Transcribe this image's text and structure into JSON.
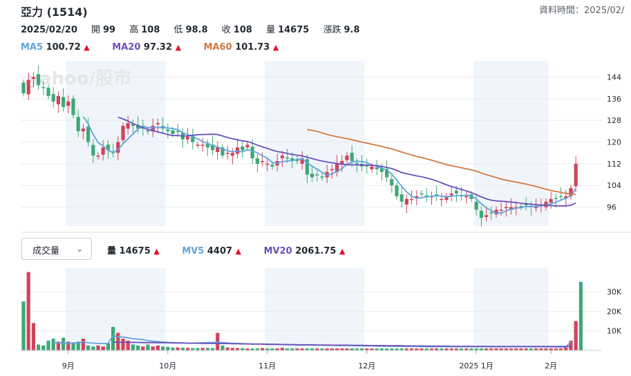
{
  "header": {
    "title": "亞力 (1514)",
    "datetime": "資料時間：2025/02/",
    "date": "2025/02/20",
    "open_label": "開",
    "open": "99",
    "high_label": "高",
    "high": "108",
    "low_label": "低",
    "low": "98.8",
    "close_label": "收",
    "close": "108",
    "volume_label": "量",
    "volume": "14675",
    "change_label": "漲跌",
    "change": "9.8"
  },
  "ma_legend": [
    {
      "name": "MA5",
      "value": "100.72",
      "color": "#5fa4dc"
    },
    {
      "name": "MA20",
      "value": "97.32",
      "color": "#6b4fbb"
    },
    {
      "name": "MA60",
      "value": "101.73",
      "color": "#d4783f"
    }
  ],
  "up_arrow": "▲",
  "watermark": "yahoo/股市",
  "volume_selector": {
    "label": "成交量",
    "chevron": "chevron-down"
  },
  "volume_legend": [
    {
      "name": "量",
      "value": "14675",
      "color": "#232a31"
    },
    {
      "name": "MV5",
      "value": "4407",
      "color": "#5fa4dc"
    },
    {
      "name": "MV20",
      "value": "2061.75",
      "color": "#6b4fbb"
    }
  ],
  "colors": {
    "up": "#d1435b",
    "down": "#3ea876",
    "band": "#f0f5fb",
    "grid": "#e8eaec"
  },
  "chart_data": {
    "type": "candlestick",
    "price_axis": {
      "ticks": [
        96,
        104,
        112,
        120,
        128,
        136,
        144
      ],
      "range": [
        89,
        150
      ]
    },
    "volume_axis": {
      "ticks": [
        "10K",
        "20K",
        "30K"
      ],
      "tick_values": [
        10000,
        20000,
        30000
      ],
      "range": [
        0,
        42000
      ]
    },
    "x_labels": [
      "9月",
      "10月",
      "11月",
      "12月",
      "2025 1月",
      "2月"
    ],
    "x_label_index": [
      9,
      29,
      49,
      69,
      91,
      106
    ],
    "shaded_months": [
      [
        9,
        28
      ],
      [
        49,
        68
      ],
      [
        91,
        105
      ]
    ],
    "closes": [
      138,
      143,
      144,
      141,
      140,
      137,
      135,
      137,
      133,
      135,
      130,
      124,
      125,
      120,
      115,
      115,
      118,
      117,
      116,
      120,
      126,
      127,
      126,
      125,
      125,
      124,
      126,
      127,
      125,
      124,
      123,
      124,
      121,
      122,
      120,
      119,
      119,
      118,
      117,
      118,
      115,
      116,
      116,
      118,
      117,
      119,
      114,
      112,
      113,
      112,
      111,
      113,
      115,
      114,
      113,
      113,
      114,
      108,
      107,
      108,
      107,
      109,
      110,
      112,
      113,
      115,
      113,
      112,
      111,
      111,
      111,
      110,
      109,
      107,
      104,
      100,
      98,
      99,
      99,
      100,
      101,
      100,
      100,
      100,
      99,
      100,
      101,
      101,
      100,
      100,
      99,
      95,
      92,
      93,
      94,
      95,
      95,
      96,
      96,
      96,
      96,
      97,
      96,
      96,
      97,
      98,
      99,
      99,
      100,
      100,
      103,
      112
    ],
    "mv5": [
      14000,
      8000,
      5800,
      4800,
      4500,
      4300,
      4000,
      3900,
      3700,
      3600,
      3800,
      4000,
      4200,
      3900,
      3700,
      3600,
      3500,
      3600,
      7500,
      7000,
      6800,
      6500,
      6000,
      5800,
      5600,
      5000,
      4700,
      4500,
      4300,
      4100,
      4000,
      3900,
      3800,
      3700,
      3700,
      3800,
      3900,
      4000,
      4100,
      4100,
      4000,
      3800,
      3700,
      3600,
      3500,
      3400,
      3300,
      3300,
      3300,
      3200,
      3200,
      3100,
      3000,
      2900,
      2900,
      2800,
      2800,
      2800,
      2800,
      2700,
      2700,
      2600,
      2600,
      2500,
      2500,
      2500,
      2500,
      2400,
      2400,
      2300,
      2300,
      2200,
      2200,
      2200,
      2100,
      2100,
      2100,
      2000,
      2000,
      2000,
      1900,
      1900,
      1900,
      1900,
      1900,
      1900,
      1900,
      1900,
      1900,
      1900,
      1900,
      1900,
      1900,
      1900,
      1900,
      1900,
      1900,
      1900,
      1900,
      1900,
      1900,
      1900,
      1900,
      1900,
      1900,
      1800,
      1800,
      1800,
      1700,
      1800,
      4400
    ],
    "mv20": [
      5500,
      5300,
      5100,
      5000,
      4900,
      4800,
      4700,
      4600,
      4500,
      4400,
      4300,
      4300,
      4200,
      4200,
      4100,
      4100,
      4000,
      4000,
      4200,
      4200,
      4200,
      4200,
      4100,
      4100,
      4000,
      4000,
      4000,
      3900,
      3900,
      3900,
      3800,
      3800,
      3800,
      3700,
      3700,
      3700,
      3600,
      3600,
      3600,
      3500,
      3500,
      3500,
      3400,
      3400,
      3300,
      3300,
      3200,
      3200,
      3200,
      3100,
      3100,
      3100,
      3000,
      3000,
      3000,
      2900,
      2900,
      2900,
      2900,
      2800,
      2800,
      2800,
      2700,
      2700,
      2700,
      2700,
      2600,
      2600,
      2600,
      2500,
      2500,
      2500,
      2500,
      2400,
      2400,
      2400,
      2400,
      2300,
      2300,
      2300,
      2300,
      2200,
      2200,
      2200,
      2200,
      2200,
      2100,
      2100,
      2100,
      2100,
      2100,
      2100,
      2100,
      2100,
      2000,
      2000,
      2000,
      2000,
      2000,
      2000,
      2000,
      2000,
      2000,
      2000,
      2000,
      2000,
      2000,
      2000,
      2000,
      2000,
      2061.75
    ],
    "ma60_start": 57,
    "volumes": [
      25000,
      40000,
      14000,
      3000,
      2500,
      5000,
      6000,
      4500,
      6500,
      4500,
      4000,
      4500,
      6000,
      2500,
      2000,
      2500,
      2000,
      3500,
      12000,
      9000,
      6000,
      5000,
      3000,
      2500,
      2000,
      3000,
      2000,
      2500,
      2000,
      1800,
      1500,
      1500,
      1400,
      1300,
      1200,
      1200,
      1300,
      1300,
      1200,
      9000,
      2500,
      1500,
      1300,
      1200,
      1200,
      1000,
      1000,
      1000,
      1200,
      1000,
      1000,
      1000,
      1300,
      1000,
      1000,
      1000,
      1000,
      1000,
      1000,
      1000,
      1000,
      1000,
      1000,
      1000,
      1000,
      1000,
      1000,
      1000,
      1000,
      1000,
      1000,
      1000,
      1000,
      1000,
      1000,
      1000,
      1000,
      1000,
      1000,
      1000,
      1000,
      1000,
      1000,
      1000,
      1000,
      1000,
      1000,
      1000,
      1000,
      1000,
      1000,
      1000,
      1000,
      1000,
      1000,
      1000,
      1000,
      1000,
      1000,
      1000,
      1000,
      1000,
      1000,
      1000,
      1000,
      1000,
      1000,
      1000,
      1000,
      1500,
      5000,
      15000,
      35000
    ]
  }
}
